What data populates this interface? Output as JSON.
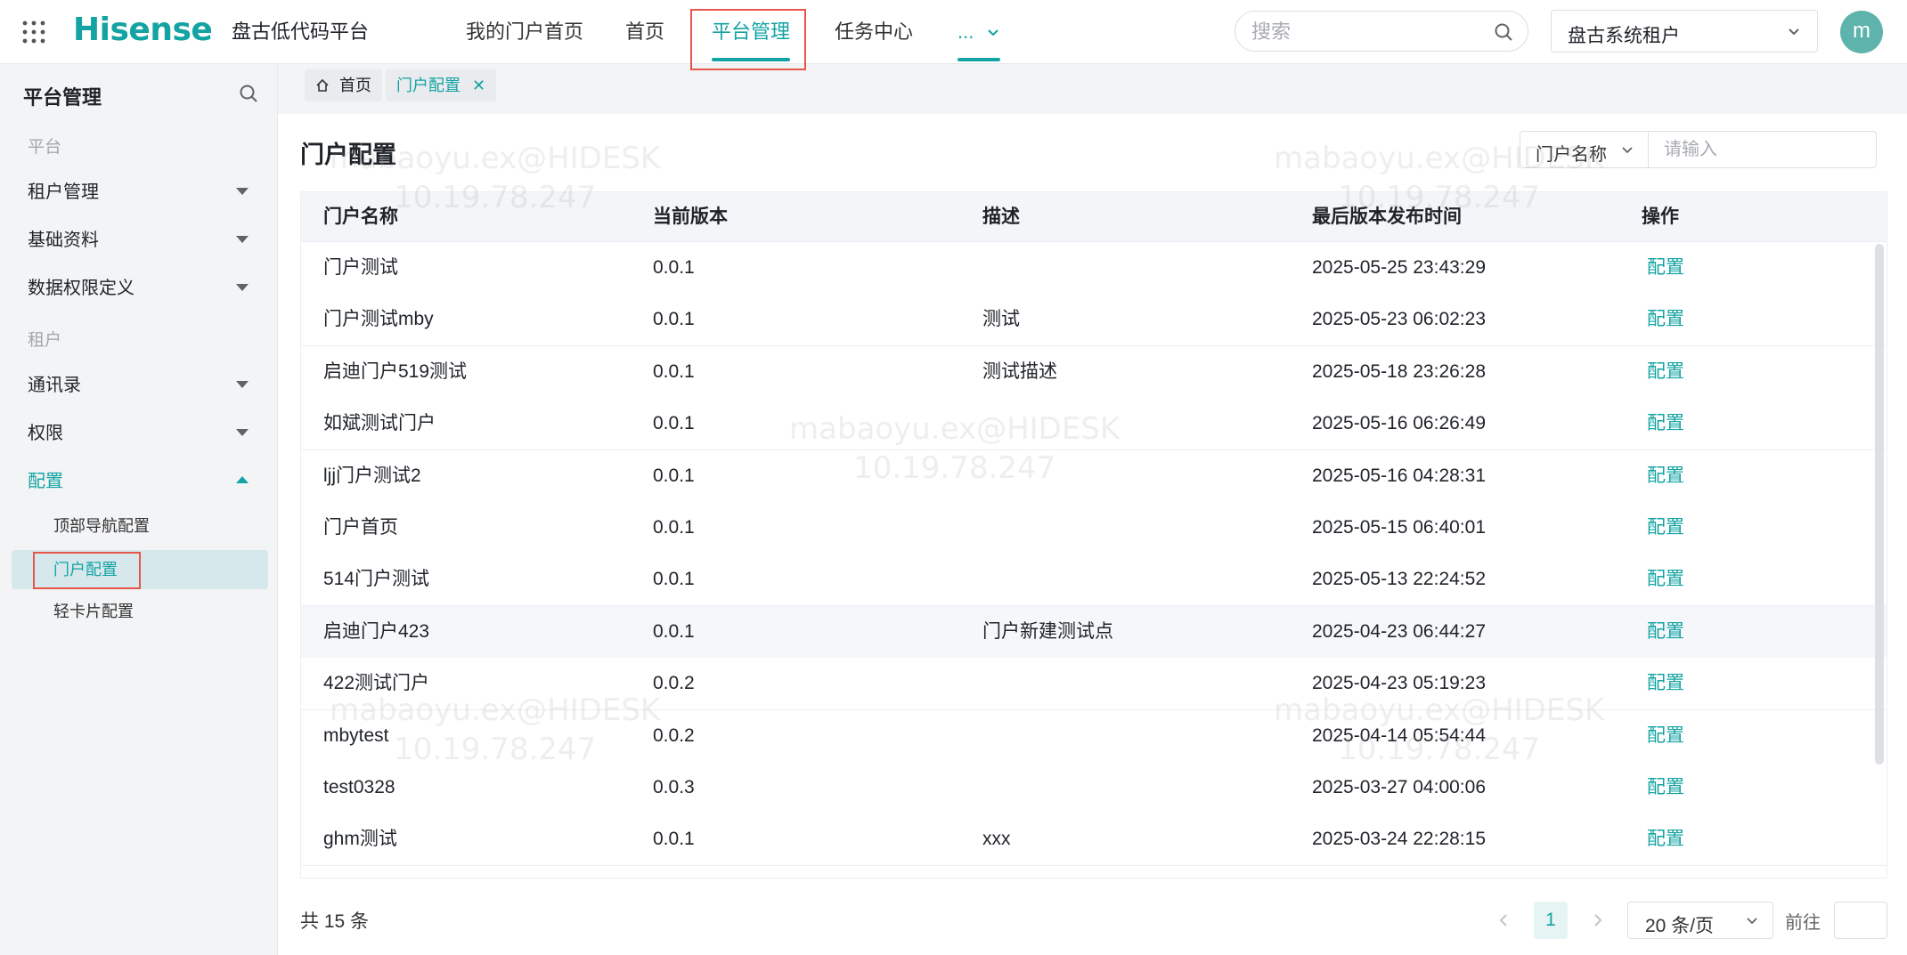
{
  "topbar": {
    "brand": "Hisense",
    "platform_name": "盘古低代码平台",
    "nav": [
      {
        "label": "我的门户首页"
      },
      {
        "label": "首页"
      },
      {
        "label": "平台管理"
      },
      {
        "label": "任务中心"
      },
      {
        "label": "..."
      }
    ],
    "active_nav": "平台管理",
    "search_placeholder": "搜索",
    "tenant": "盘古系统租户",
    "avatar_initial": "m"
  },
  "sidebar": {
    "title": "平台管理",
    "group_platform": "平台",
    "item_tenant": "租户管理",
    "item_base": "基础资料",
    "item_data_perm": "数据权限定义",
    "group_tenant": "租户",
    "item_contacts": "通讯录",
    "item_perm": "权限",
    "item_config": "配置",
    "sub_topnav": "顶部导航配置",
    "sub_portal": "门户配置",
    "sub_card": "轻卡片配置"
  },
  "tabs": {
    "home": "首页",
    "current": "门户配置"
  },
  "page": {
    "title": "门户配置",
    "filter_field": "门户名称",
    "filter_placeholder": "请输入"
  },
  "table": {
    "headers": {
      "name": "门户名称",
      "version": "当前版本",
      "desc": "描述",
      "time": "最后版本发布时间",
      "op": "操作"
    },
    "rows": [
      {
        "name": "门户测试",
        "version": "0.0.1",
        "desc": "",
        "time": "2025-05-25 23:43:29",
        "op": "配置"
      },
      {
        "name": "门户测试mby",
        "version": "0.0.1",
        "desc": "测试",
        "time": "2025-05-23 06:02:23",
        "op": "配置"
      },
      {
        "name": "启迪门户519测试",
        "version": "0.0.1",
        "desc": "测试描述",
        "time": "2025-05-18 23:26:28",
        "op": "配置"
      },
      {
        "name": "如斌测试门户",
        "version": "0.0.1",
        "desc": "",
        "time": "2025-05-16 06:26:49",
        "op": "配置"
      },
      {
        "name": "ljj门户测试2",
        "version": "0.0.1",
        "desc": "",
        "time": "2025-05-16 04:28:31",
        "op": "配置"
      },
      {
        "name": "门户首页",
        "version": "0.0.1",
        "desc": "",
        "time": "2025-05-15 06:40:01",
        "op": "配置"
      },
      {
        "name": "514门户测试",
        "version": "0.0.1",
        "desc": "",
        "time": "2025-05-13 22:24:52",
        "op": "配置"
      },
      {
        "name": "启迪门户423",
        "version": "0.0.1",
        "desc": "门户新建测试点",
        "time": "2025-04-23 06:44:27",
        "op": "配置"
      },
      {
        "name": "422测试门户",
        "version": "0.0.2",
        "desc": "",
        "time": "2025-04-23 05:19:23",
        "op": "配置"
      },
      {
        "name": "mbytest",
        "version": "0.0.2",
        "desc": "",
        "time": "2025-04-14 05:54:44",
        "op": "配置"
      },
      {
        "name": "test0328",
        "version": "0.0.3",
        "desc": "",
        "time": "2025-03-27 04:00:06",
        "op": "配置"
      },
      {
        "name": "ghm测试",
        "version": "0.0.1",
        "desc": "xxx",
        "time": "2025-03-24 22:28:15",
        "op": "配置"
      }
    ]
  },
  "pagination": {
    "total_text": "共 15 条",
    "current_page": "1",
    "page_size": "20 条/页",
    "goto_label": "前往",
    "goto_value": ""
  },
  "watermark": {
    "user": "mabaoyu.ex@HIDESK",
    "ip": "10.19.78.247"
  },
  "colors": {
    "accent": "#14a3a3",
    "highlight_box": "#e8554a",
    "sidebar_bg": "#f3f4f6"
  }
}
